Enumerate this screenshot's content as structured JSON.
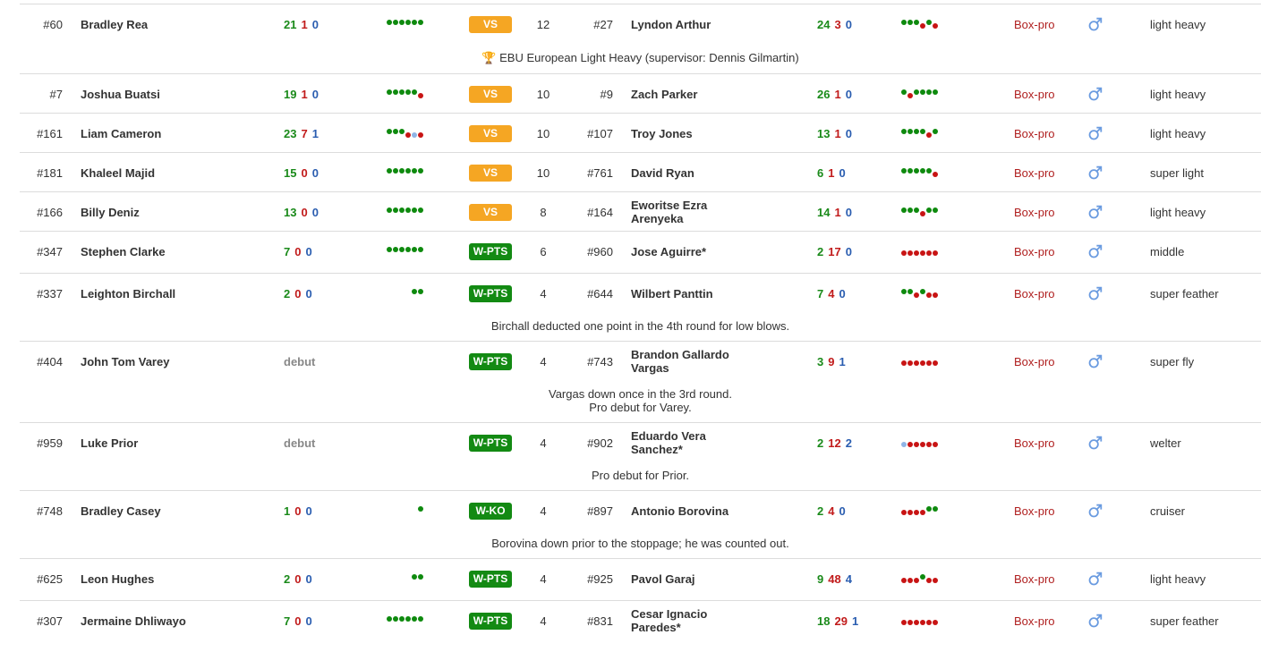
{
  "bouts": [
    {
      "rank1": "#60",
      "name1": "Bradley Rea",
      "rec1": [
        "21",
        "1",
        "0"
      ],
      "form1": [
        "W",
        "W",
        "W",
        "W",
        "W",
        "W"
      ],
      "result": "VS",
      "result_type": "vs",
      "rounds": "12",
      "rank2": "#27",
      "name2": "Lyndon Arthur",
      "rec2": [
        "24",
        "3",
        "0"
      ],
      "form2": [
        "W",
        "W",
        "W",
        "L",
        "W",
        "L"
      ],
      "promo": "Box-pro",
      "division": "light heavy",
      "note": [
        "🏆 EBU European Light Heavy (supervisor: Dennis Gilmartin)"
      ]
    },
    {
      "rank1": "#7",
      "name1": "Joshua Buatsi",
      "rec1": [
        "19",
        "1",
        "0"
      ],
      "form1": [
        "W",
        "W",
        "W",
        "W",
        "W",
        "L"
      ],
      "result": "VS",
      "result_type": "vs",
      "rounds": "10",
      "rank2": "#9",
      "name2": "Zach Parker",
      "rec2": [
        "26",
        "1",
        "0"
      ],
      "form2": [
        "W",
        "L",
        "W",
        "W",
        "W",
        "W"
      ],
      "promo": "Box-pro",
      "division": "light heavy",
      "note": []
    },
    {
      "rank1": "#161",
      "name1": "Liam Cameron",
      "rec1": [
        "23",
        "7",
        "1"
      ],
      "form1": [
        "W",
        "W",
        "W",
        "L",
        "D",
        "L"
      ],
      "result": "VS",
      "result_type": "vs",
      "rounds": "10",
      "rank2": "#107",
      "name2": "Troy Jones",
      "rec2": [
        "13",
        "1",
        "0"
      ],
      "form2": [
        "W",
        "W",
        "W",
        "W",
        "L",
        "W"
      ],
      "promo": "Box-pro",
      "division": "light heavy",
      "note": []
    },
    {
      "rank1": "#181",
      "name1": "Khaleel Majid",
      "rec1": [
        "15",
        "0",
        "0"
      ],
      "form1": [
        "W",
        "W",
        "W",
        "W",
        "W",
        "W"
      ],
      "result": "VS",
      "result_type": "vs",
      "rounds": "10",
      "rank2": "#761",
      "name2": "David Ryan",
      "rec2": [
        "6",
        "1",
        "0"
      ],
      "form2": [
        "W",
        "W",
        "W",
        "W",
        "W",
        "L"
      ],
      "promo": "Box-pro",
      "division": "super light",
      "note": []
    },
    {
      "rank1": "#166",
      "name1": "Billy Deniz",
      "rec1": [
        "13",
        "0",
        "0"
      ],
      "form1": [
        "W",
        "W",
        "W",
        "W",
        "W",
        "W"
      ],
      "result": "VS",
      "result_type": "vs",
      "rounds": "8",
      "rank2": "#164",
      "name2": "Eworitse Ezra Arenyeka",
      "rec2": [
        "14",
        "1",
        "0"
      ],
      "form2": [
        "W",
        "W",
        "W",
        "L",
        "W",
        "W"
      ],
      "promo": "Box-pro",
      "division": "light heavy",
      "note": []
    },
    {
      "rank1": "#347",
      "name1": "Stephen Clarke",
      "rec1": [
        "7",
        "0",
        "0"
      ],
      "form1": [
        "W",
        "W",
        "W",
        "W",
        "W",
        "W"
      ],
      "result": "W-PTS",
      "result_type": "win",
      "rounds": "6",
      "rank2": "#960",
      "name2": "Jose Aguirre*",
      "rec2": [
        "2",
        "17",
        "0"
      ],
      "form2": [
        "L",
        "L",
        "L",
        "L",
        "L",
        "L"
      ],
      "promo": "Box-pro",
      "division": "middle",
      "note": []
    },
    {
      "rank1": "#337",
      "name1": "Leighton Birchall",
      "rec1": [
        "2",
        "0",
        "0"
      ],
      "form1": [
        "W",
        "W"
      ],
      "result": "W-PTS",
      "result_type": "win",
      "rounds": "4",
      "rank2": "#644",
      "name2": "Wilbert Panttin",
      "rec2": [
        "7",
        "4",
        "0"
      ],
      "form2": [
        "W",
        "W",
        "L",
        "W",
        "L",
        "L"
      ],
      "promo": "Box-pro",
      "division": "super feather",
      "note": [
        "Birchall deducted one point in the 4th round for low blows."
      ]
    },
    {
      "rank1": "#404",
      "name1": "John Tom Varey",
      "debut1": "debut",
      "form1": [],
      "result": "W-PTS",
      "result_type": "win",
      "rounds": "4",
      "rank2": "#743",
      "name2": "Brandon Gallardo Vargas",
      "rec2": [
        "3",
        "9",
        "1"
      ],
      "form2": [
        "L",
        "L",
        "L",
        "L",
        "L",
        "L"
      ],
      "promo": "Box-pro",
      "division": "super fly",
      "note": [
        "Vargas down once in the 3rd round.",
        "Pro debut for Varey."
      ]
    },
    {
      "rank1": "#959",
      "name1": "Luke Prior",
      "debut1": "debut",
      "form1": [],
      "result": "W-PTS",
      "result_type": "win",
      "rounds": "4",
      "rank2": "#902",
      "name2": "Eduardo Vera Sanchez*",
      "rec2": [
        "2",
        "12",
        "2"
      ],
      "form2": [
        "D",
        "L",
        "L",
        "L",
        "L",
        "L"
      ],
      "promo": "Box-pro",
      "division": "welter",
      "note": [
        "Pro debut for Prior."
      ]
    },
    {
      "rank1": "#748",
      "name1": "Bradley Casey",
      "rec1": [
        "1",
        "0",
        "0"
      ],
      "form1": [
        "W"
      ],
      "result": "W-KO",
      "result_type": "win",
      "rounds": "4",
      "rank2": "#897",
      "name2": "Antonio Borovina",
      "rec2": [
        "2",
        "4",
        "0"
      ],
      "form2": [
        "L",
        "L",
        "L",
        "L",
        "W",
        "W"
      ],
      "promo": "Box-pro",
      "division": "cruiser",
      "note": [
        "Borovina down prior to the stoppage; he was counted out."
      ]
    },
    {
      "rank1": "#625",
      "name1": "Leon Hughes",
      "rec1": [
        "2",
        "0",
        "0"
      ],
      "form1": [
        "W",
        "W"
      ],
      "result": "W-PTS",
      "result_type": "win",
      "rounds": "4",
      "rank2": "#925",
      "name2": "Pavol Garaj",
      "rec2": [
        "9",
        "48",
        "4"
      ],
      "form2": [
        "L",
        "L",
        "L",
        "W",
        "L",
        "L"
      ],
      "promo": "Box-pro",
      "division": "light heavy",
      "note": []
    },
    {
      "rank1": "#307",
      "name1": "Jermaine Dhliwayo",
      "rec1": [
        "7",
        "0",
        "0"
      ],
      "form1": [
        "W",
        "W",
        "W",
        "W",
        "W",
        "W"
      ],
      "result": "W-PTS",
      "result_type": "win",
      "rounds": "4",
      "rank2": "#831",
      "name2": "Cesar Ignacio Paredes*",
      "rec2": [
        "18",
        "29",
        "1"
      ],
      "form2": [
        "L",
        "L",
        "L",
        "L",
        "L",
        "L"
      ],
      "promo": "Box-pro",
      "division": "super feather",
      "note": []
    }
  ],
  "colors": {
    "win": "#138a13",
    "vs": "#f5a623",
    "loss": "#c11b1b",
    "draw": "#2a5db0",
    "promoter": "#b02020",
    "male": "#6a9be0"
  },
  "icons": {
    "sex": "male-icon"
  }
}
